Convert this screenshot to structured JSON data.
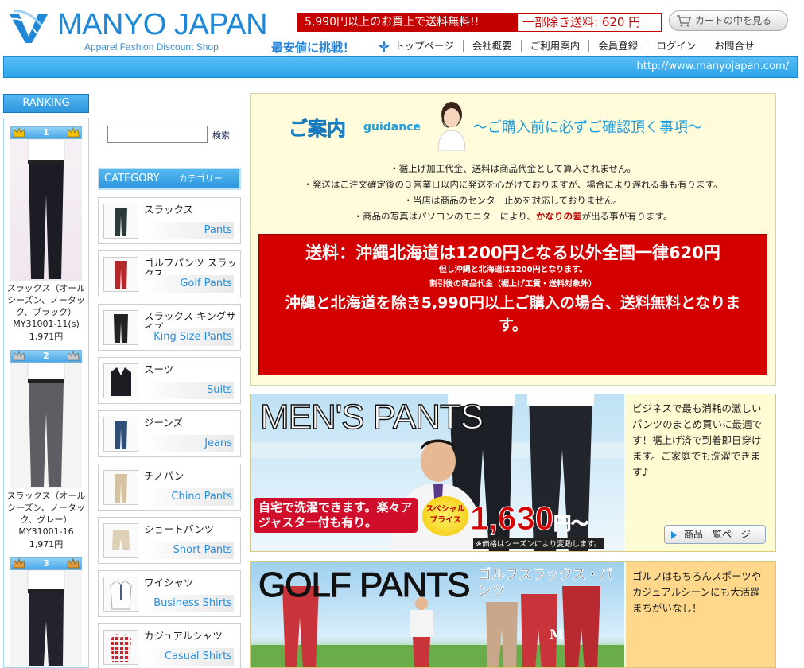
{
  "header": {
    "logo_text": "MANYO JAPAN",
    "logo_sub": "Apparel Fashion Discount Shop",
    "ship_left": "5,990円以上のお買上で送料無料!!",
    "ship_right": "一部除き送料: 620 円",
    "cart_label": "カートの中を見る",
    "slogan": "最安値に挑戦！",
    "url": "http://www.manyojapan.com/"
  },
  "nav": [
    "トップページ",
    "会社概要",
    "ご利用案内",
    "会員登録",
    "ログイン",
    "お問合せ"
  ],
  "ranking": {
    "title": "RANKING",
    "items": [
      {
        "rank": "1",
        "name": "スラックス（オールシーズン、ノータック、ブラック）MY31001-11(s)",
        "price": "1,971円"
      },
      {
        "rank": "2",
        "name": "スラックス（オールシーズン、ノータック、グレー）MY31001-16",
        "price": "1,971円"
      },
      {
        "rank": "3",
        "name": "",
        "price": ""
      }
    ]
  },
  "search": {
    "button": "検索",
    "placeholder": ""
  },
  "category": {
    "title_en": "CATEGORY",
    "title_jp": "カテゴリー",
    "items": [
      {
        "jp": "スラックス",
        "en": "Pants",
        "icon": "pants-icon"
      },
      {
        "jp": "ゴルフパンツ スラックス",
        "en": "Golf Pants",
        "icon": "golf-pants-icon"
      },
      {
        "jp": "スラックス キングサイズ",
        "en": "King Size Pants",
        "icon": "king-size-pants-icon"
      },
      {
        "jp": "スーツ",
        "en": "Suits",
        "icon": "suit-icon"
      },
      {
        "jp": "ジーンズ",
        "en": "Jeans",
        "icon": "jeans-icon"
      },
      {
        "jp": "チノパン",
        "en": "Chino Pants",
        "icon": "chino-pants-icon"
      },
      {
        "jp": "ショートパンツ",
        "en": "Short Pants",
        "icon": "short-pants-icon"
      },
      {
        "jp": "ワイシャツ",
        "en": "Business Shirts",
        "icon": "business-shirt-icon"
      },
      {
        "jp": "カジュアルシャツ",
        "en": "Casual Shirts",
        "icon": "casual-shirt-icon"
      }
    ]
  },
  "guidance": {
    "title": "ご案内",
    "title_en": "guidance",
    "subtitle": "〜ご購入前に必ずご確認頂く事項〜",
    "notes": [
      "・裾上げ加工代金、送料は商品代金として算入されません。",
      "・発送はご注文確定後の３営業日以内に発送を心がけておりますが、場合により遅れる事も有ります。",
      "・当店は商品のセンター止めを対応しておりません。"
    ],
    "note4_pre": "・商品の写真はパソコンのモニターにより、",
    "note4_red": "かなりの差",
    "note4_post": "が出る事が有ります。",
    "red_main": "送料：沖縄北海道は1200円となる以外全国一律620円",
    "red_small1": "但し沖縄と北海道は1200円となります。",
    "red_small2": "割引後の商品代金（裾上げ工賃・送料対象外）",
    "red_main2": "沖縄と北海道を除き5,990円以上ご購入の場合、送料無料となります。"
  },
  "banner1": {
    "title_a": "MEN",
    "title_b": "'S PANTS",
    "copy": "自宅で洗濯できます。楽々アジャスター付も有り。",
    "badge": "スペシャルプライス",
    "price": "1,630",
    "price_unit": "円〜",
    "note": "※価格はシーズンにより変動します。",
    "side_text": "ビジネスで最も消耗の激しいパンツのまとめ買いに最適です！裾上げ済で到着即日穿けます。ご家庭でも洗濯できます♪",
    "button": "商品一覧ページ"
  },
  "banner2": {
    "title": "GOLF PANTS",
    "jp": "ゴルフスラックス・パンツ",
    "side_text": "ゴルフはもちろんスポーツやカジュアルシーンにも大活躍まちがいなし！"
  }
}
